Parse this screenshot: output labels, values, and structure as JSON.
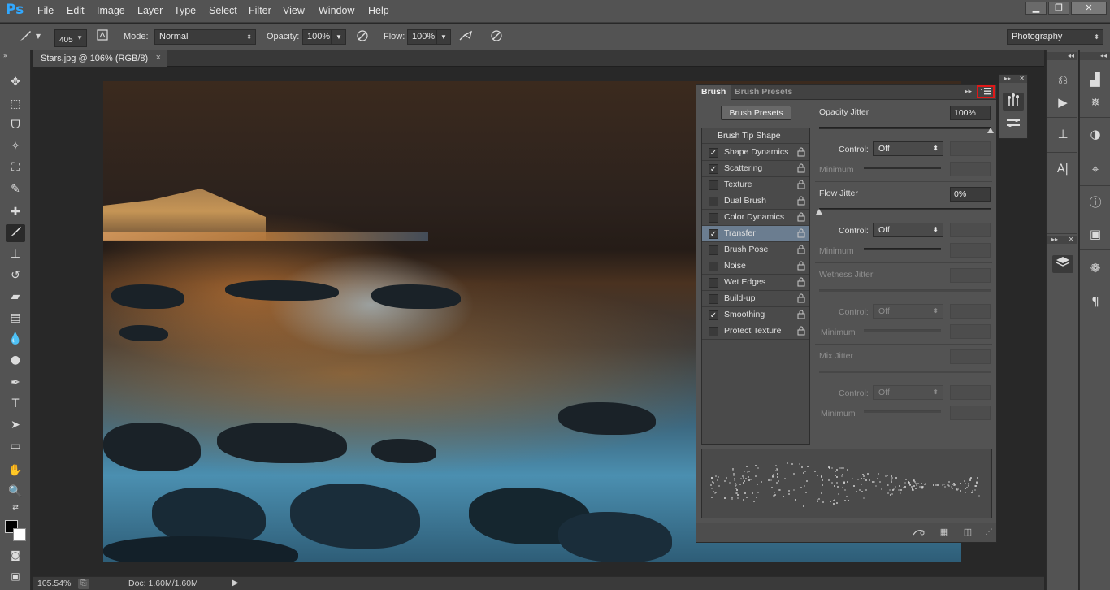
{
  "app": {
    "logo_text": "Ps",
    "menu": [
      "File",
      "Edit",
      "Image",
      "Layer",
      "Type",
      "Select",
      "Filter",
      "View",
      "Window",
      "Help"
    ],
    "window_controls": [
      "▁",
      "❐",
      "✕"
    ]
  },
  "options_bar": {
    "brush_size": "405",
    "mode_label": "Mode:",
    "mode_value": "Normal",
    "opacity_label": "Opacity:",
    "opacity_value": "100%",
    "flow_label": "Flow:",
    "flow_value": "100%",
    "workspace_value": "Photography"
  },
  "document": {
    "tab_title": "Stars.jpg @ 106% (RGB/8)",
    "tab_close": "×"
  },
  "brush_panel": {
    "tabs": [
      "Brush",
      "Brush Presets"
    ],
    "presets_button": "Brush Presets",
    "menu_icon": "panel-menu-icon",
    "tip_shape_label": "Brush Tip Shape",
    "options": [
      {
        "label": "Shape Dynamics",
        "checked": true,
        "selected": false
      },
      {
        "label": "Scattering",
        "checked": true,
        "selected": false
      },
      {
        "label": "Texture",
        "checked": false,
        "selected": false
      },
      {
        "label": "Dual Brush",
        "checked": false,
        "selected": false
      },
      {
        "label": "Color Dynamics",
        "checked": false,
        "selected": false
      },
      {
        "label": "Transfer",
        "checked": true,
        "selected": true
      },
      {
        "label": "Brush Pose",
        "checked": false,
        "selected": false
      },
      {
        "label": "Noise",
        "checked": false,
        "selected": false
      },
      {
        "label": "Wet Edges",
        "checked": false,
        "selected": false
      },
      {
        "label": "Build-up",
        "checked": false,
        "selected": false
      },
      {
        "label": "Smoothing",
        "checked": true,
        "selected": false
      },
      {
        "label": "Protect Texture",
        "checked": false,
        "selected": false
      }
    ],
    "opacity_jitter": {
      "label": "Opacity Jitter",
      "value": "100%",
      "slider_fraction": 1.0
    },
    "opacity_control": {
      "label": "Control:",
      "value": "Off"
    },
    "opacity_minimum_label": "Minimum",
    "flow_jitter": {
      "label": "Flow Jitter",
      "value": "0%",
      "slider_fraction": 0.0
    },
    "flow_control": {
      "label": "Control:",
      "value": "Off"
    },
    "flow_minimum_label": "Minimum",
    "wetness_jitter": {
      "label": "Wetness Jitter"
    },
    "wetness_control": {
      "label": "Control:",
      "value": "Off"
    },
    "wetness_minimum_label": "Minimum",
    "mix_jitter": {
      "label": "Mix Jitter"
    },
    "mix_control": {
      "label": "Control:",
      "value": "Off"
    },
    "mix_minimum_label": "Minimum"
  },
  "status_bar": {
    "zoom": "105.54%",
    "doc_info": "Doc: 1.60M/1.60M"
  },
  "colors": {
    "foreground": "#000000",
    "background": "#ffffff",
    "selection_highlight": "#e01818"
  }
}
